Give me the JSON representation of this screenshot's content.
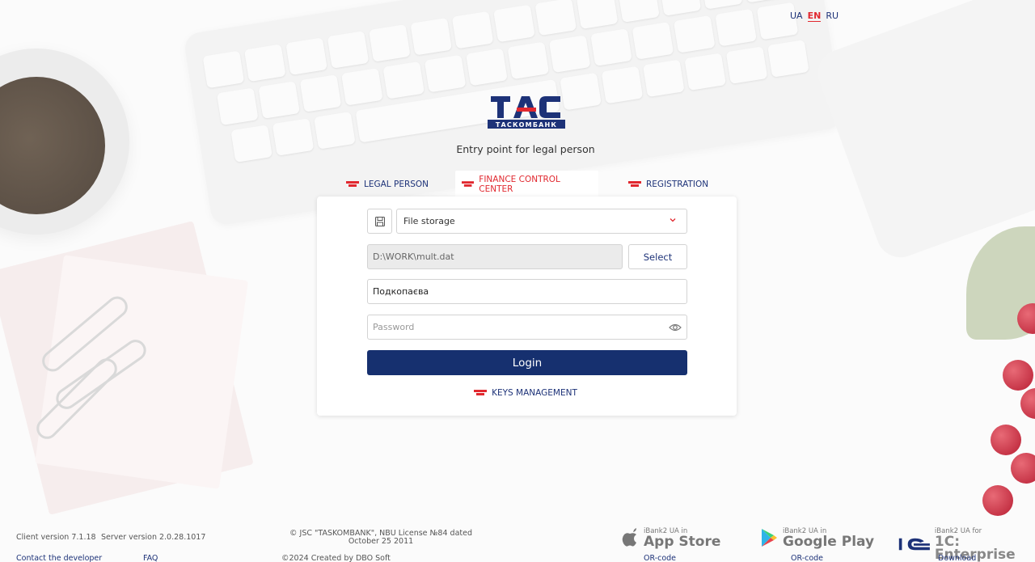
{
  "languages": [
    {
      "code": "UA",
      "active": false
    },
    {
      "code": "EN",
      "active": true
    },
    {
      "code": "RU",
      "active": false
    }
  ],
  "brand": {
    "logo_text": "TAC",
    "logo_subtext": "ТАСКОМБАНК"
  },
  "subtitle": "Entry point for legal person",
  "tabs": [
    {
      "label": "LEGAL PERSON",
      "active": false
    },
    {
      "label": "FINANCE CONTROL CENTER",
      "active": true
    },
    {
      "label": "REGISTRATION",
      "active": false
    }
  ],
  "form": {
    "storage_select": {
      "value": "File storage"
    },
    "file_path": {
      "value": "D:\\WORK\\mult.dat"
    },
    "select_button": "Select",
    "username": {
      "value": "Подкопаєва"
    },
    "password": {
      "placeholder": "Password",
      "value": ""
    },
    "login_button": "Login",
    "keys_management": "KEYS MANAGEMENT"
  },
  "footer": {
    "client_version": "Client version 7.1.18",
    "server_version": "Server version  2.0.28.1017",
    "contact": "Contact the developer",
    "faq": "FAQ",
    "copyright_line1": "© JSC \"TASKOMBANK\", NBU License №84 dated",
    "copyright_line2": "October 25 2011",
    "created_by": "©2024 Created by DBO Soft",
    "stores": [
      {
        "small": "iBank2 UA in",
        "big": "App Store",
        "link": "OR-code",
        "icon": "apple-icon"
      },
      {
        "small": "iBank2 UA in",
        "big": "Google Play",
        "link": "OR-code",
        "icon": "google-play-icon"
      },
      {
        "small": "iBank2 UA for",
        "big": "1C: Enterprise",
        "link": "Download",
        "icon": "1c-icon"
      }
    ]
  },
  "colors": {
    "brand_navy": "#16306f",
    "brand_red": "#e1282f"
  }
}
